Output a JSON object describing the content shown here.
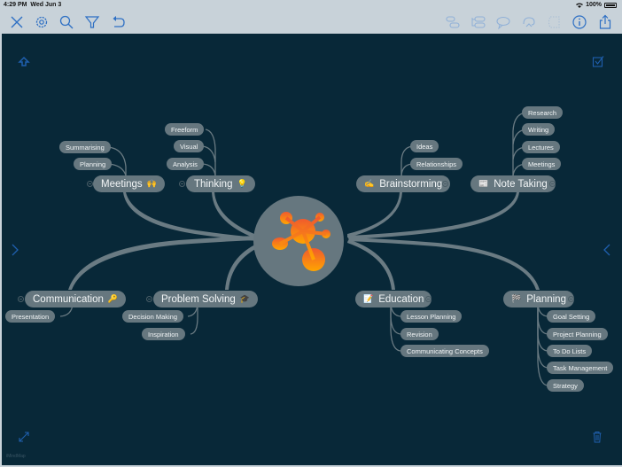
{
  "status_bar": {
    "time": "4:29 PM",
    "date": "Wed Jun 3",
    "wifi_icon": "wifi-icon",
    "battery": "100%"
  },
  "toolbar": {
    "left_buttons": [
      {
        "name": "close",
        "icon": "close-icon"
      },
      {
        "name": "settings",
        "icon": "gear-icon"
      },
      {
        "name": "search",
        "icon": "search-icon"
      },
      {
        "name": "filter",
        "icon": "filter-icon"
      },
      {
        "name": "undo",
        "icon": "undo-icon"
      }
    ],
    "right_buttons": [
      {
        "name": "add-topic",
        "icon": "add-topic-icon"
      },
      {
        "name": "add-subtopic",
        "icon": "add-subtopic-icon"
      },
      {
        "name": "callout",
        "icon": "callout-icon"
      },
      {
        "name": "relationship",
        "icon": "relationship-icon"
      },
      {
        "name": "boundary",
        "icon": "boundary-icon"
      },
      {
        "name": "info",
        "icon": "info-icon"
      },
      {
        "name": "share",
        "icon": "share-icon"
      }
    ]
  },
  "canvas": {
    "background": "#082838",
    "node_color": "#66777f",
    "link_color": "#6a7b83",
    "accent": "#1f5fae",
    "watermark": "iMindMap",
    "corner_controls": {
      "top_left": "home-up-icon",
      "top_right": "select-checkbox-icon",
      "left_mid": "chevron-right-icon",
      "right_mid": "chevron-left-icon",
      "bottom_left": "expand-icon",
      "bottom_right": "trash-icon"
    }
  },
  "central_topic": {
    "icon": "mindmap-logo-icon",
    "colors": [
      "#f06a2e",
      "#f7931e",
      "#ffb000"
    ]
  },
  "branches": [
    {
      "label": "Meetings",
      "emoji": "🙌",
      "children": [
        "Summarising",
        "Planning"
      ]
    },
    {
      "label": "Thinking",
      "emoji": "💡",
      "children": [
        "Freeform",
        "Visual",
        "Analysis"
      ]
    },
    {
      "label": "Brainstorming",
      "emoji": "✍",
      "children": [
        "Ideas",
        "Relationships"
      ]
    },
    {
      "label": "Note Taking",
      "emoji": "📰",
      "children": [
        "Research",
        "Writing",
        "Lectures",
        "Meetings"
      ]
    },
    {
      "label": "Communication",
      "emoji": "🔑",
      "children": [
        "Presentation"
      ]
    },
    {
      "label": "Problem Solving",
      "emoji": "🎓",
      "children": [
        "Decision Making",
        "Inspiration"
      ]
    },
    {
      "label": "Education",
      "emoji": "📝",
      "children": [
        "Lesson Planning",
        "Revision",
        "Communicating Concepts"
      ]
    },
    {
      "label": "Planning",
      "emoji": "🏁",
      "children": [
        "Goal Setting",
        "Project Planning",
        "To Do Lists",
        "Task Management",
        "Strategy"
      ]
    }
  ]
}
